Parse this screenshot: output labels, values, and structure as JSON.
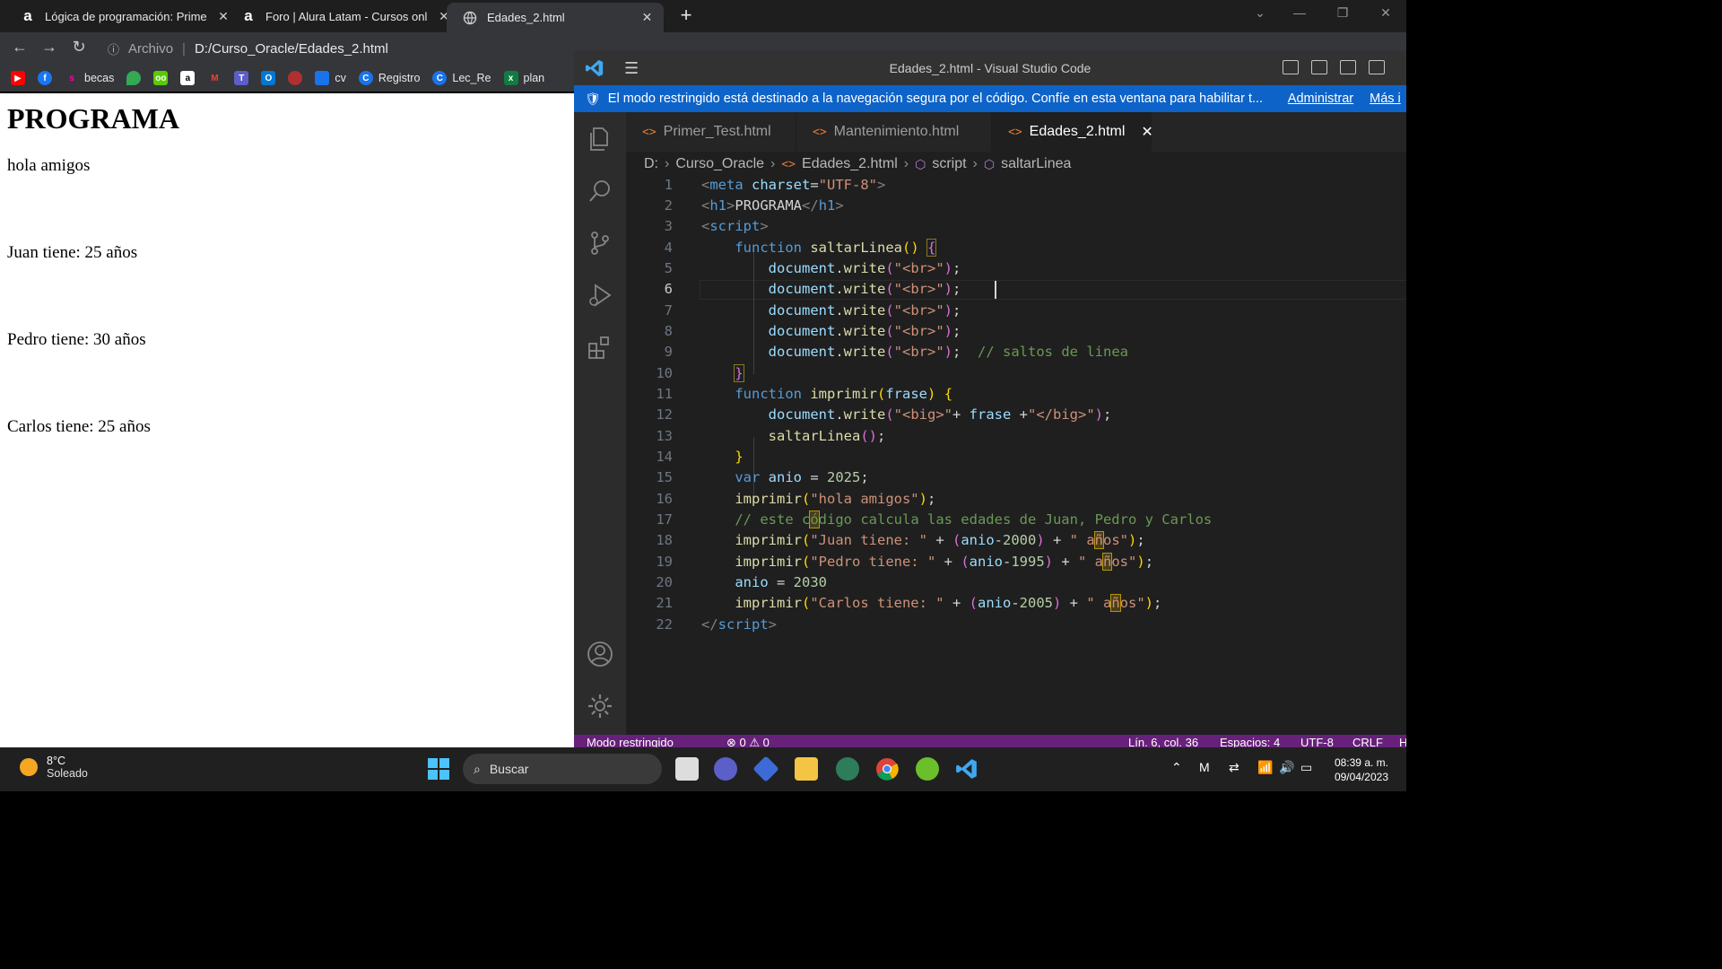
{
  "browser": {
    "tabs": [
      {
        "favicon": "a",
        "title": "Lógica de programación: Primeros"
      },
      {
        "favicon": "a",
        "title": "Foro | Alura Latam - Cursos online"
      },
      {
        "favicon": "globe",
        "title": "Edades_2.html"
      }
    ],
    "url_scheme_label": "Archivo",
    "url": "D:/Curso_Oracle/Edades_2.html",
    "bookmarks": [
      "becas",
      "cv",
      "Registro",
      "Lec_Re",
      "plan"
    ]
  },
  "page": {
    "heading": "PROGRAMA",
    "lines": [
      "hola amigos",
      "Juan tiene: 25 años",
      "Pedro tiene: 30 años",
      "Carlos tiene: 25 años"
    ]
  },
  "vscode": {
    "title": "Edades_2.html - Visual Studio Code",
    "restricted_message": "El modo restringido está destinado a la navegación segura por el código. Confíe en esta ventana para habilitar t...",
    "restricted_manage": "Administrar",
    "restricted_more": "Más i",
    "tabs": [
      "Primer_Test.html",
      "Mantenimiento.html",
      "Edades_2.html"
    ],
    "breadcrumb": [
      "D:",
      "Curso_Oracle",
      "Edades_2.html",
      "script",
      "saltarLinea"
    ],
    "line_numbers": [
      "1",
      "2",
      "3",
      "4",
      "5",
      "6",
      "7",
      "8",
      "9",
      "10",
      "11",
      "12",
      "13",
      "14",
      "15",
      "16",
      "17",
      "18",
      "19",
      "20",
      "21",
      "22"
    ],
    "status": {
      "mode": "Modo restringido",
      "problems": "⊗ 0 ⚠ 0",
      "position": "Lín. 6, col. 36",
      "spaces": "Espacios: 4",
      "encoding": "UTF-8",
      "eol": "CRLF",
      "lang": "H"
    }
  },
  "taskbar": {
    "temp": "8°C",
    "condition": "Soleado",
    "search": "Buscar",
    "time": "08:39 a. m.",
    "date": "09/04/2023"
  }
}
